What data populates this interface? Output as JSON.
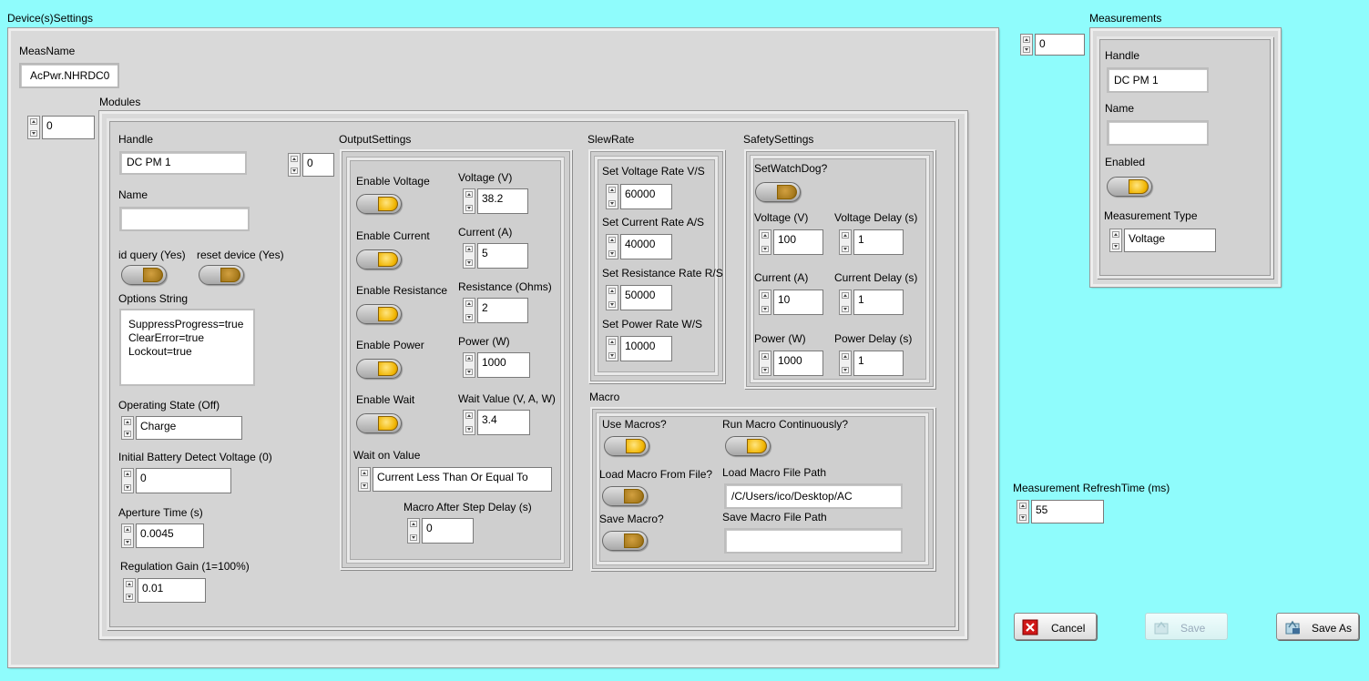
{
  "device_settings": {
    "title": "Device(s)Settings",
    "meas_name_label": "MeasName",
    "meas_name_value": "AcPwr.NHRDC0",
    "modules_label": "Modules",
    "modules_index": "0",
    "module": {
      "handle_label": "Handle",
      "handle_value": "DC PM 1",
      "name_label": "Name",
      "name_value": "",
      "id_query_label": "id query (Yes)",
      "reset_device_label": "reset device (Yes)",
      "options_string_label": "Options String",
      "options_lines": [
        "SuppressProgress=true",
        "ClearError=true",
        "Lockout=true"
      ],
      "operating_state_label": "Operating State (Off)",
      "operating_state_value": "Charge",
      "initial_battery_label": "Initial Battery Detect Voltage (0)",
      "initial_battery_value": "0",
      "aperture_label": "Aperture Time (s)",
      "aperture_value": "0.0045",
      "regulation_label": "Regulation Gain (1=100%)",
      "regulation_value": "0.01",
      "output_index": "0"
    },
    "output_settings": {
      "title": "OutputSettings",
      "enable_voltage": "Enable Voltage",
      "enable_current": "Enable Current",
      "enable_resistance": "Enable Resistance",
      "enable_power": "Enable Power",
      "enable_wait": "Enable Wait",
      "voltage_label": "Voltage (V)",
      "voltage_value": "38.2",
      "current_label": "Current (A)",
      "current_value": "5",
      "resistance_label": "Resistance (Ohms)",
      "resistance_value": "2",
      "power_label": "Power (W)",
      "power_value": "1000",
      "wait_value_label": "Wait Value (V, A, W)",
      "wait_value_value": "3.4",
      "wait_on_value_label": "Wait on Value",
      "wait_on_value_value": "Current Less Than Or Equal To",
      "macro_after_label": "Macro After Step Delay  (s)",
      "macro_after_value": "0"
    },
    "slew_rate": {
      "title": "SlewRate",
      "voltage_rate_label": "Set Voltage Rate V/S",
      "voltage_rate_value": "60000",
      "current_rate_label": "Set Current Rate A/S",
      "current_rate_value": "40000",
      "resistance_rate_label": "Set Resistance Rate R/S",
      "resistance_rate_value": "50000",
      "power_rate_label": "Set Power Rate W/S",
      "power_rate_value": "10000"
    },
    "safety_settings": {
      "title": "SafetySettings",
      "watchdog_label": "SetWatchDog?",
      "voltage_label": "Voltage (V)",
      "voltage_value": "100",
      "voltage_delay_label": "Voltage Delay (s)",
      "voltage_delay_value": "1",
      "current_label": "Current (A)",
      "current_value": "10",
      "current_delay_label": "Current Delay (s)",
      "current_delay_value": "1",
      "power_label": "Power (W)",
      "power_value": "1000",
      "power_delay_label": "Power Delay (s)",
      "power_delay_value": "1"
    },
    "macro": {
      "title": "Macro",
      "use_macros_label": "Use Macros?",
      "run_continuously_label": "Run Macro Continuously?",
      "load_from_file_label": "Load Macro From File?",
      "load_path_label": "Load Macro File Path",
      "load_path_value": "/C/Users/ico/Desktop/AC",
      "save_macro_label": "Save Macro?",
      "save_path_label": "Save Macro File Path",
      "save_path_value": ""
    }
  },
  "measurements": {
    "title": "Measurements",
    "index": "0",
    "handle_label": "Handle",
    "handle_value": "DC PM 1",
    "name_label": "Name",
    "name_value": "",
    "enabled_label": "Enabled",
    "type_label": "Measurement Type",
    "type_value": "Voltage",
    "refresh_label": "Measurement RefreshTime (ms)",
    "refresh_value": "55"
  },
  "buttons": {
    "cancel": "Cancel",
    "save": "Save",
    "save_as": "Save As"
  },
  "colors": {
    "background": "#8ffcfc",
    "toggle_on": "#f0b400",
    "cancel_icon": "#d01818"
  }
}
